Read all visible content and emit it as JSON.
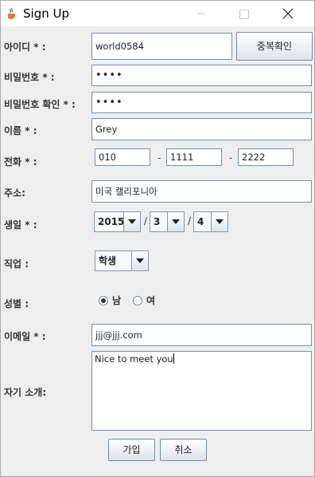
{
  "window": {
    "title": "Sign Up",
    "icon": "java-cup-icon",
    "minimize_icon": "minimize-icon",
    "maximize_icon": "maximize-icon",
    "close_icon": "close-icon"
  },
  "form": {
    "id_label": "아이디 * :",
    "id_value": "world0584",
    "check_button": "중복확인",
    "pw_label": "비밀번호 * :",
    "pw_value": "••••",
    "pw_confirm_label": "비밀번호 확인 * :",
    "pw_confirm_value": "••••",
    "name_label": "이름 * :",
    "name_value": "Grey",
    "phone_label": "전화 * :",
    "phone_1": "010",
    "phone_2": "1111",
    "phone_3": "2222",
    "phone_sep": "-",
    "address_label": "주소:",
    "address_value": "미국 캘리포니아",
    "birth_label": "생일 * :",
    "birth_year": "2015",
    "birth_month": "3",
    "birth_day": "4",
    "birth_sep": "/",
    "job_label": "직업 :",
    "job_value": "학생",
    "gender_label": "성별 :",
    "gender_male": "남",
    "gender_female": "여",
    "gender_selected": "남",
    "email_label": "이메일 * :",
    "email_value": "jjj@jjj.com",
    "intro_label": "자기 소개:",
    "intro_value": "Nice to meet you"
  },
  "buttons": {
    "join": "가입",
    "cancel": "취소"
  }
}
